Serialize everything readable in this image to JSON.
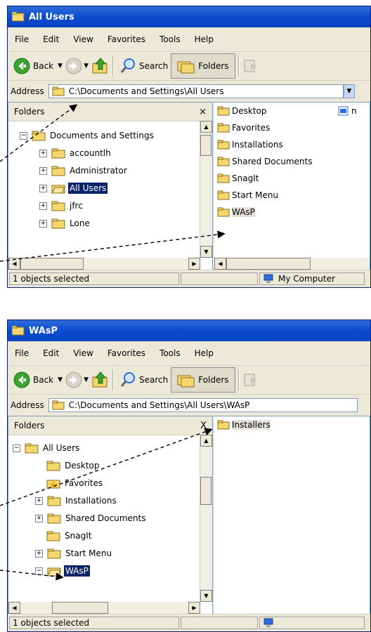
{
  "window1": {
    "title": "All Users",
    "menu": [
      "File",
      "Edit",
      "View",
      "Favorites",
      "Tools",
      "Help"
    ],
    "toolbar": {
      "back_label": "Back",
      "search_label": "Search",
      "folders_label": "Folders"
    },
    "address_label": "Address",
    "address_value": "C:\\Documents and Settings\\All Users",
    "folders_header": "Folders",
    "close_glyph": "×",
    "tree": [
      "Documents and Settings",
      "accountlh",
      "Administrator",
      "All Users",
      "jfrc",
      "Lone"
    ],
    "list": [
      "Desktop",
      "Favorites",
      "Installations",
      "Shared Documents",
      "SnagIt",
      "Start Menu",
      "WAsP"
    ],
    "list_right_partial": "n",
    "status_left": "1 objects selected",
    "status_right": "My Computer"
  },
  "window2": {
    "title": "WAsP",
    "menu": [
      "File",
      "Edit",
      "View",
      "Favorites",
      "Tools",
      "Help"
    ],
    "toolbar": {
      "back_label": "Back",
      "search_label": "Search",
      "folders_label": "Folders"
    },
    "address_label": "Address",
    "address_value": "C:\\Documents and Settings\\All Users\\WAsP",
    "folders_header": "Folders",
    "close_glyph": "X",
    "tree": [
      "All Users",
      "Desktop",
      "Favorites",
      "Installations",
      "Shared Documents",
      "SnagIt",
      "Start Menu",
      "WAsP"
    ],
    "list": [
      "Installers"
    ],
    "status_left": "1 objects selected"
  },
  "colors": {
    "title_blue": "#0a4ccf",
    "selection": "#0a246a",
    "folder_yellow": "#f5d76e",
    "back_green": "#3aa52e"
  }
}
